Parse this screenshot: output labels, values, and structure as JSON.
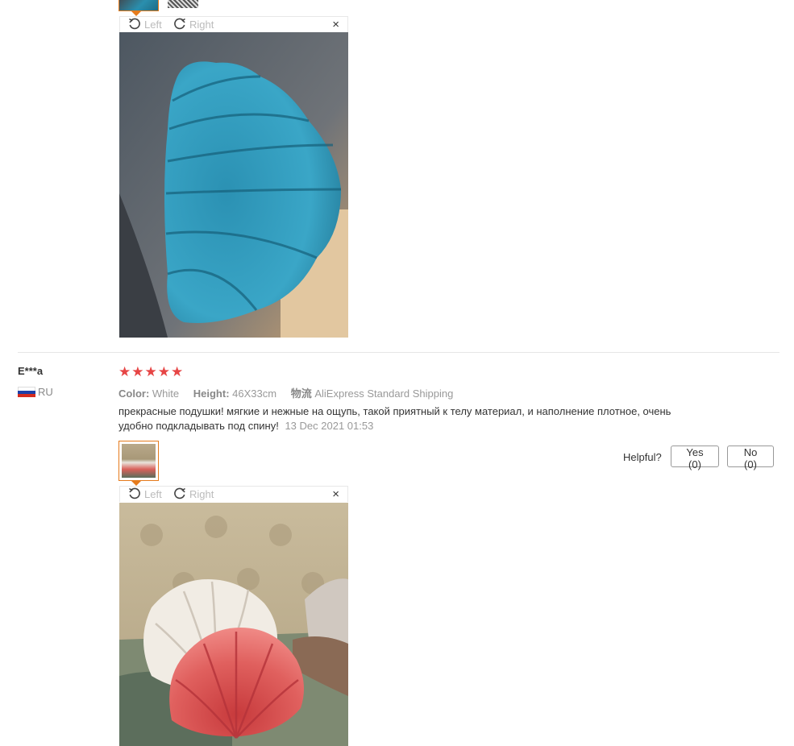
{
  "viewer": {
    "left_label": "Left",
    "right_label": "Right",
    "close_glyph": "×"
  },
  "review": {
    "reviewer": "E***a",
    "country": "RU",
    "rating": "★★★★★",
    "color_key": "Color:",
    "color_value": "White",
    "height_key": "Height:",
    "height_value": "46X33cm",
    "shipping_key": "物流",
    "shipping_value": "AliExpress Standard Shipping",
    "text": "прекрасные подушки! мягкие и нежные на ощупь, такой приятный к телу материал, и наполнение плотное, очень удобно подкладывать под спину!",
    "date": "13 Dec 2021 01:53",
    "helpful_label": "Helpful?",
    "yes_label": "Yes (0)",
    "no_label": "No (0)"
  },
  "colors": {
    "accent_orange": "#e57b1c",
    "star_red": "#e64545"
  }
}
